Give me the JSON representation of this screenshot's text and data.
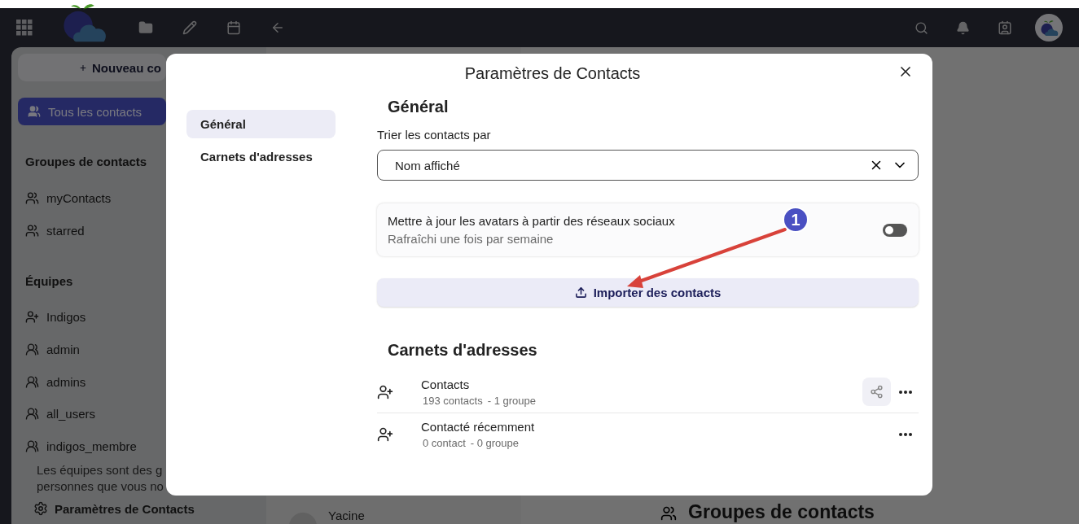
{
  "sidebar": {
    "new_button": "Nouveau co",
    "items": [
      {
        "label": "Tous les contacts",
        "selected": true
      }
    ],
    "groups_heading": "Groupes de contacts",
    "groups": [
      {
        "label": "myContacts"
      },
      {
        "label": "starred"
      }
    ],
    "teams_heading": "Équipes",
    "teams": [
      {
        "label": "Indigos",
        "kind": "owner"
      },
      {
        "label": "admin",
        "kind": "team"
      },
      {
        "label": "admins",
        "kind": "team"
      },
      {
        "label": "all_users",
        "kind": "team"
      },
      {
        "label": "indigos_membre",
        "kind": "team"
      }
    ],
    "teams_note": [
      "Les équipes sont des g",
      "personnes que vous no"
    ],
    "settings_link": "Paramètres de Contacts"
  },
  "contact_list": {
    "first_name": "Yacine"
  },
  "main": {
    "heading": "Groupes de contacts"
  },
  "modal": {
    "title": "Paramètres de Contacts",
    "nav": [
      {
        "label": "Général",
        "selected": true
      },
      {
        "label": "Carnets d'adresses",
        "selected": false
      }
    ],
    "general_heading": "Général",
    "sort_label": "Trier les contacts par",
    "sort_value": "Nom affiché",
    "avatar_update": {
      "title": "Mettre à jour les avatars à partir des réseaux sociaux",
      "subtitle": "Rafraîchi une fois par semaine",
      "on": false
    },
    "import_button": "Importer des contacts",
    "books_heading": "Carnets d'adresses",
    "address_books": [
      {
        "name": "Contacts",
        "count": "193 contacts",
        "groups": "- 1 groupe",
        "shareable": true
      },
      {
        "name": "Contacté récemment",
        "count": "0 contact",
        "groups": "- 0 groupe",
        "shareable": false
      }
    ]
  },
  "annotation": {
    "badge": "1"
  }
}
